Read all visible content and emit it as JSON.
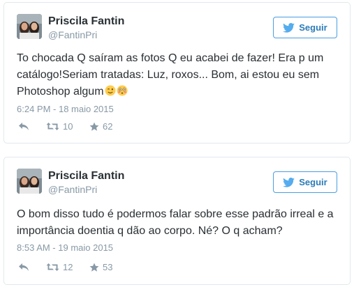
{
  "tweets": [
    {
      "user": {
        "name": "Priscila Fantin",
        "handle": "@FantinPri"
      },
      "follow_label": "Seguir",
      "text": "To chocada Q saíram as fotos Q eu acabei de fazer! Era p um catálogo!Seriam tratadas: Luz, roxos... Bom, ai estou eu sem Photoshop algum",
      "emojis": [
        "winking-face-emoji",
        "flushed-face-emoji"
      ],
      "timestamp": "6:24 PM - 18 maio 2015",
      "retweets": "10",
      "favorites": "62"
    },
    {
      "user": {
        "name": "Priscila Fantin",
        "handle": "@FantinPri"
      },
      "follow_label": "Seguir",
      "text": "O bom disso tudo é podermos falar sobre esse padrão irreal e a importância doentia q dão ao corpo. Né? O q acham?",
      "timestamp": "8:53 AM - 19 maio 2015",
      "retweets": "12",
      "favorites": "53"
    }
  ],
  "colors": {
    "border": "#e1e8ed",
    "text": "#292f33",
    "muted": "#8899a6",
    "link_blue": "#2b7bb9",
    "bird_blue": "#55acee",
    "emoji_yellow": "#ffcc4d"
  },
  "icons": [
    "twitter-bird-icon",
    "reply-icon",
    "retweet-icon",
    "favorite-star-icon"
  ]
}
